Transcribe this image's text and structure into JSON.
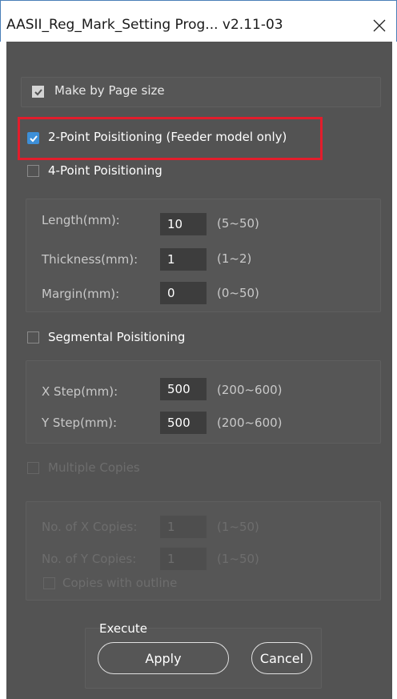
{
  "window": {
    "title": "AASII_Reg_Mark_Setting Prog... v2.11-03"
  },
  "options": {
    "make_by_page_size": {
      "label": "Make by Page size",
      "checked": true
    },
    "two_point": {
      "label": "2-Point Poisitioning (Feeder model only)",
      "checked": true
    },
    "four_point": {
      "label": "4-Point Poisitioning",
      "checked": false
    },
    "segmental": {
      "label": "Segmental Poisitioning",
      "checked": false
    },
    "multiple_copies": {
      "label": "Multiple Copies",
      "checked": false,
      "disabled": true
    },
    "copies_outline": {
      "label": "Copies with outline",
      "checked": false,
      "disabled": true
    }
  },
  "mark_settings": {
    "length": {
      "label": "Length(mm):",
      "value": "10",
      "range": "(5~50)"
    },
    "thickness": {
      "label": "Thickness(mm):",
      "value": "1",
      "range": "(1~2)"
    },
    "margin": {
      "label": "Margin(mm):",
      "value": "0",
      "range": "(0~50)"
    }
  },
  "segment_settings": {
    "x_step": {
      "label": "X Step(mm):",
      "value": "500",
      "range": "(200~600)"
    },
    "y_step": {
      "label": "Y Step(mm):",
      "value": "500",
      "range": "(200~600)"
    }
  },
  "copies_settings": {
    "x_copies": {
      "label": "No. of X Copies:",
      "value": "1",
      "range": "(1~50)"
    },
    "y_copies": {
      "label": "No. of Y Copies:",
      "value": "1",
      "range": "(1~50)"
    }
  },
  "execute": {
    "group_label": "Execute",
    "apply_label": "Apply",
    "cancel_label": "Cancel"
  },
  "colors": {
    "background": "#535353",
    "highlight": "#e21d2c",
    "check_blue": "#3d8fd8"
  }
}
